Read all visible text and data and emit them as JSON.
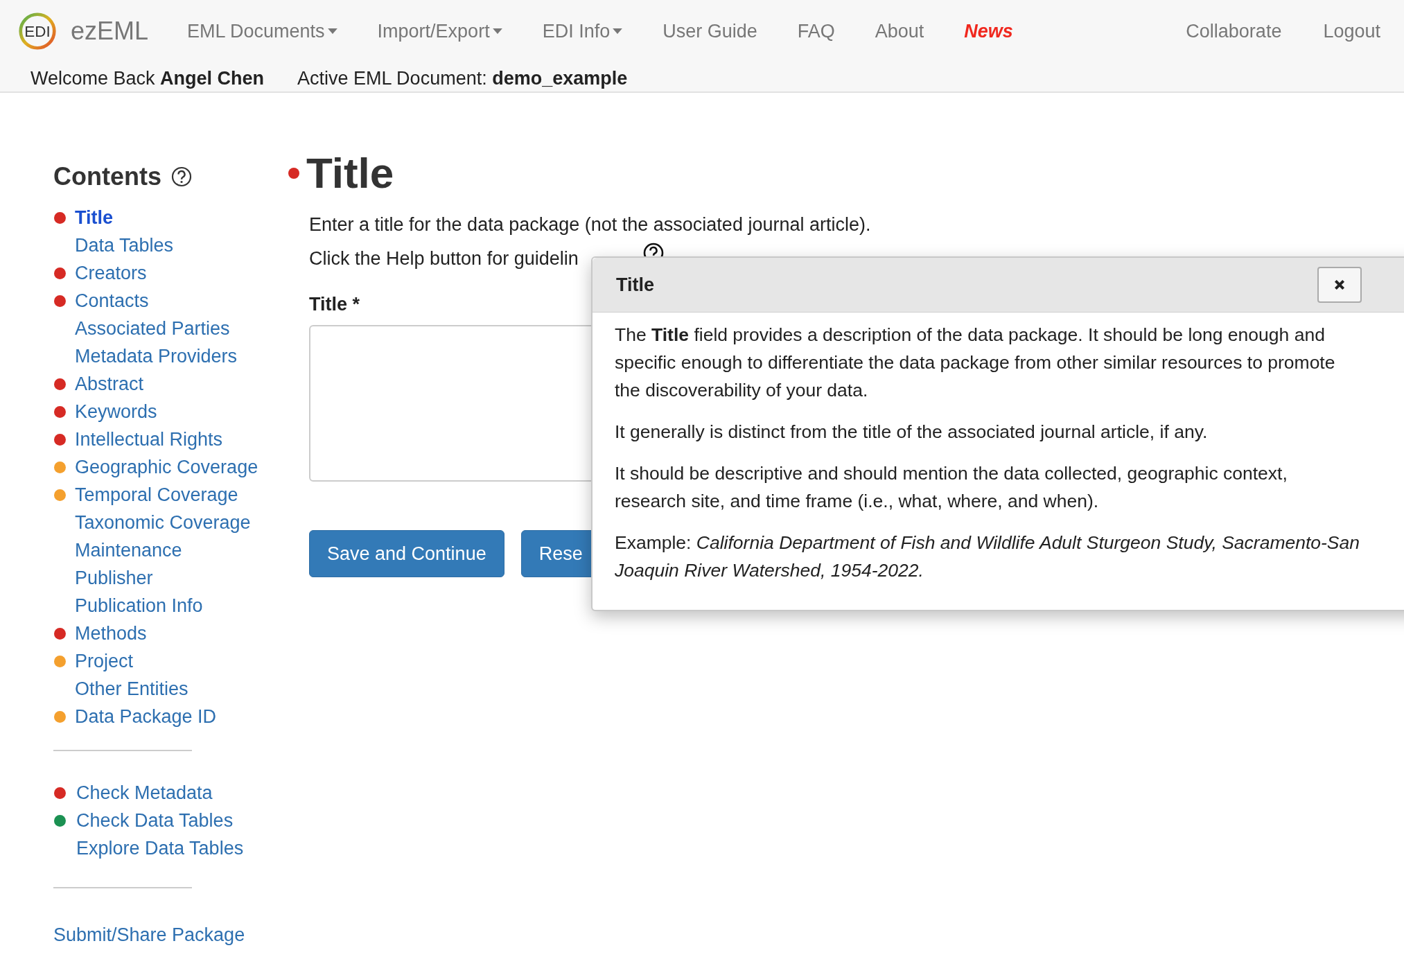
{
  "navbar": {
    "logo_text": "EDI",
    "brand": "ezEML",
    "menu": [
      {
        "label": "EML Documents",
        "kind": "dropdown"
      },
      {
        "label": "Import/Export",
        "kind": "dropdown"
      },
      {
        "label": "EDI Info",
        "kind": "dropdown"
      },
      {
        "label": "User Guide",
        "kind": "link"
      },
      {
        "label": "FAQ",
        "kind": "link"
      },
      {
        "label": "About",
        "kind": "link"
      },
      {
        "label": "News",
        "kind": "highlight"
      }
    ],
    "right_menu": [
      "Collaborate",
      "Logout"
    ],
    "welcome": "Welcome Back **Angel Chen**",
    "active_document": "Active EML Document: **demo_example**"
  },
  "sidebar": {
    "title": "Contents",
    "items": [
      {
        "label": "Title",
        "color": "#d62a24",
        "selected": true
      },
      {
        "label": "Data Tables",
        "selected": false
      },
      {
        "label": "Creators",
        "color": "#d62a24",
        "selected": false
      },
      {
        "label": "Contacts",
        "color": "#d62a24",
        "selected": false
      },
      {
        "label": "Associated Parties",
        "selected": false
      },
      {
        "label": "Metadata Providers",
        "selected": false
      },
      {
        "label": "Abstract",
        "color": "#d62a24",
        "selected": false
      },
      {
        "label": "Keywords",
        "color": "#d62a24",
        "selected": false
      },
      {
        "label": "Intellectual Rights",
        "color": "#d62a24",
        "selected": false
      },
      {
        "label": "Geographic Coverage",
        "color": "#f4a02e",
        "selected": false
      },
      {
        "label": "Temporal Coverage",
        "color": "#f4a02e",
        "selected": false
      },
      {
        "label": "Taxonomic Coverage",
        "selected": false
      },
      {
        "label": "Maintenance",
        "selected": false
      },
      {
        "label": "Publisher",
        "selected": false
      },
      {
        "label": "Publication Info",
        "selected": false
      },
      {
        "label": "Methods",
        "color": "#d62a24",
        "selected": false
      },
      {
        "label": "Project",
        "color": "#f4a02e",
        "selected": false
      },
      {
        "label": "Other Entities",
        "selected": false
      },
      {
        "label": "Data Package ID",
        "color": "#f4a02e",
        "selected": false
      }
    ],
    "tools": [
      {
        "label": "Check Metadata",
        "color": "#d62a24"
      },
      {
        "label": "Check Data Tables",
        "color": "#1b9152"
      },
      {
        "label": "Explore Data Tables"
      }
    ],
    "submit": "Submit/Share Package"
  },
  "main": {
    "heading": "Title",
    "color": "#d62a24",
    "intro": "Enter a title for the data package (not the associated journal article).",
    "help_line": "Click the Help button for guidelin",
    "field_label": "Title *",
    "buttons": [
      "Save and Continue",
      "Rese"
    ]
  },
  "dialog": {
    "title": "Title",
    "paragraphs": [
      "The **Title** field provides a description of the data package. It should be long enough and specific enough to differentiate the data package from other similar resources to promote the discoverability of your data.",
      "It generally is distinct from the title of the associated journal article, if any.",
      "It should be descriptive and should mention the data collected, geographic context, research site, and time frame (i.e., what, where, and when).",
      "Example: *California Department of Fish and Wildlife Adult Sturgeon Study, Sacramento-San Joaquin River Watershed, 1954-2022.*"
    ]
  }
}
